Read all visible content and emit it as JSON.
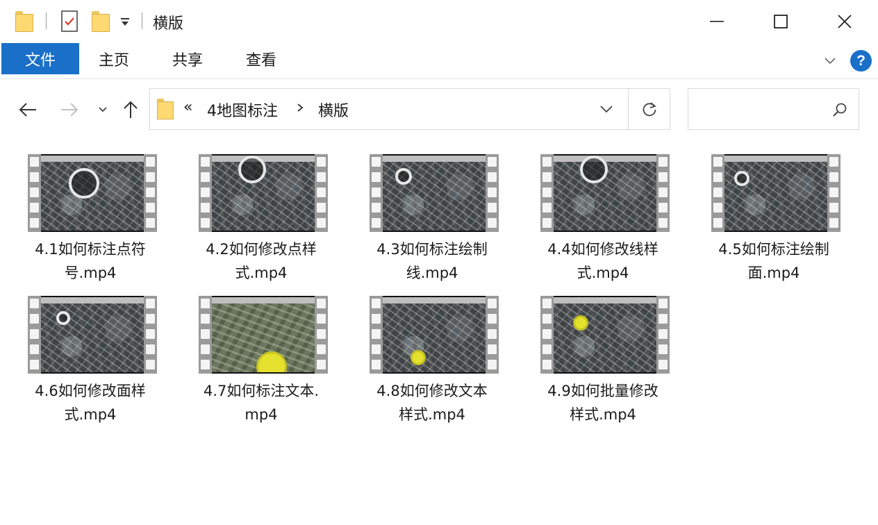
{
  "window": {
    "title": "横版",
    "accent_color": "#1a6fc8"
  },
  "ribbon": {
    "tabs": [
      {
        "label": "文件",
        "active": true
      },
      {
        "label": "主页"
      },
      {
        "label": "共享"
      },
      {
        "label": "查看"
      }
    ],
    "help_label": "?"
  },
  "address_bar": {
    "overflow": "«",
    "crumbs": [
      "4地图标注",
      "横版"
    ]
  },
  "search": {
    "placeholder": ""
  },
  "files": [
    {
      "name": "4.1如何标注点符\n号.mp4"
    },
    {
      "name": "4.2如何修改点样\n式.mp4"
    },
    {
      "name": "4.3如何标注绘制\n线.mp4"
    },
    {
      "name": "4.4如何修改线样\n式.mp4"
    },
    {
      "name": "4.5如何标注绘制\n面.mp4"
    },
    {
      "name": "4.6如何修改面样\n式.mp4"
    },
    {
      "name": "4.7如何标注文本.\nmp4"
    },
    {
      "name": "4.8如何修改文本\n样式.mp4"
    },
    {
      "name": "4.9如何批量修改\n样式.mp4"
    }
  ],
  "icons": [
    "folder-icon",
    "properties-icon",
    "dropdown-icon",
    "minimize-icon",
    "maximize-icon",
    "close-icon",
    "back-icon",
    "forward-icon",
    "recent-icon",
    "up-icon",
    "refresh-icon",
    "search-icon",
    "help-icon",
    "video-file-icon"
  ]
}
